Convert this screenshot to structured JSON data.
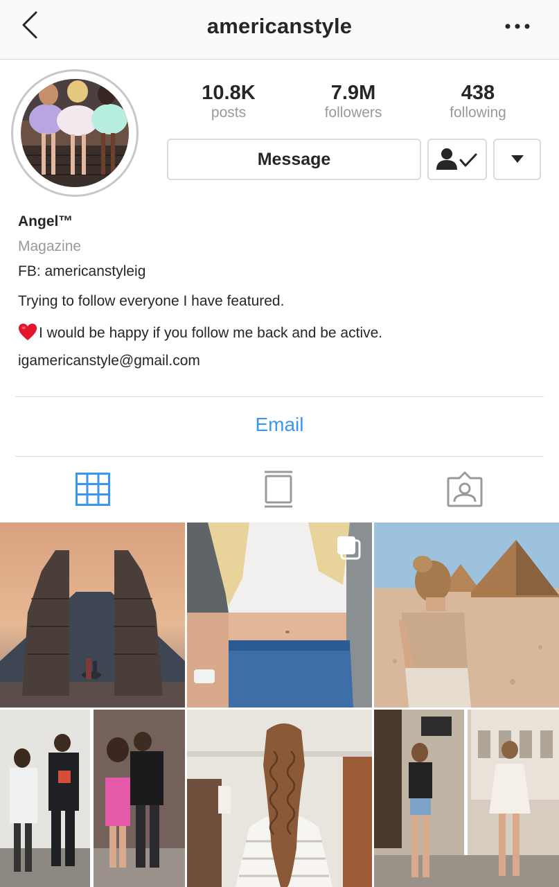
{
  "header": {
    "username": "americanstyle",
    "back_icon": "chevron-left-icon",
    "more_icon": "ellipsis-icon"
  },
  "profile": {
    "stats": [
      {
        "value": "10.8K",
        "label": "posts"
      },
      {
        "value": "7.9M",
        "label": "followers"
      },
      {
        "value": "438",
        "label": "following"
      }
    ],
    "message_label": "Message",
    "follow_icon": "person-check-icon",
    "dropdown_icon": "caret-down-icon"
  },
  "bio": {
    "name": "Angel™",
    "category": "Magazine",
    "fb": "FB: americanstyleig",
    "line1": "Trying to follow everyone I have featured.",
    "line2": "I would be happy if you follow me back and be active.",
    "email_text": "igamericanstyle@gmail.com"
  },
  "actions": {
    "email_label": "Email"
  },
  "tabs": [
    {
      "name": "grid",
      "icon": "grid-icon",
      "active": true
    },
    {
      "name": "igtv",
      "icon": "igtv-icon",
      "active": false
    },
    {
      "name": "tagged",
      "icon": "tagged-person-icon",
      "active": false
    }
  ],
  "colors": {
    "accent": "#3897f0",
    "text": "#262626",
    "muted": "#999999",
    "border": "#dbdbdb"
  }
}
